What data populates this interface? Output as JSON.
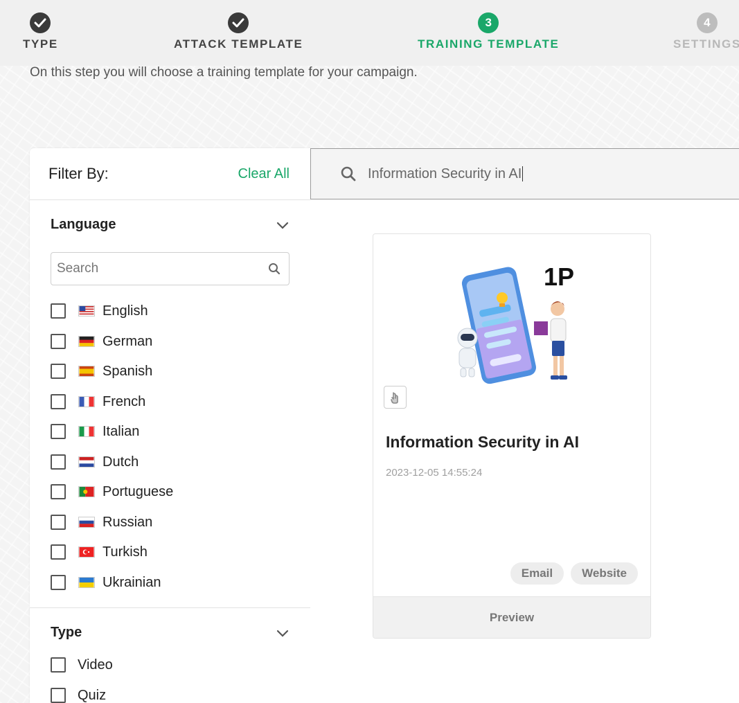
{
  "stepper": {
    "steps": [
      {
        "label": "TYPE",
        "marker": "",
        "state": "done"
      },
      {
        "label": "ATTACK TEMPLATE",
        "marker": "",
        "state": "done"
      },
      {
        "label": "TRAINING TEMPLATE",
        "marker": "3",
        "state": "active"
      },
      {
        "label": "SETTINGS",
        "marker": "4",
        "state": "future"
      }
    ]
  },
  "intro_text": "On this step you will choose a training template for your campaign.",
  "filter": {
    "title": "Filter By:",
    "clear_all": "Clear All",
    "language": {
      "title": "Language",
      "search_placeholder": "Search",
      "options": [
        {
          "label": "English",
          "flag": "us-flag-icon"
        },
        {
          "label": "German",
          "flag": "de-flag-icon"
        },
        {
          "label": "Spanish",
          "flag": "es-flag-icon"
        },
        {
          "label": "French",
          "flag": "fr-flag-icon"
        },
        {
          "label": "Italian",
          "flag": "it-flag-icon"
        },
        {
          "label": "Dutch",
          "flag": "nl-flag-icon"
        },
        {
          "label": "Portuguese",
          "flag": "pt-flag-icon"
        },
        {
          "label": "Russian",
          "flag": "ru-flag-icon"
        },
        {
          "label": "Turkish",
          "flag": "tr-flag-icon"
        },
        {
          "label": "Ukrainian",
          "flag": "ua-flag-icon"
        }
      ]
    },
    "type": {
      "title": "Type",
      "options": [
        {
          "label": "Video"
        },
        {
          "label": "Quiz"
        }
      ]
    }
  },
  "search": {
    "value": "Information Security in AI",
    "icon": "search-icon"
  },
  "card": {
    "badge": "1P",
    "title": "Information Security in AI",
    "date": "2023-12-05 14:55:24",
    "tags": [
      "Email",
      "Website"
    ],
    "preview_label": "Preview"
  },
  "colors": {
    "accent": "#1aa769",
    "done": "#3a3a3a",
    "future": "#bdbdbd"
  }
}
